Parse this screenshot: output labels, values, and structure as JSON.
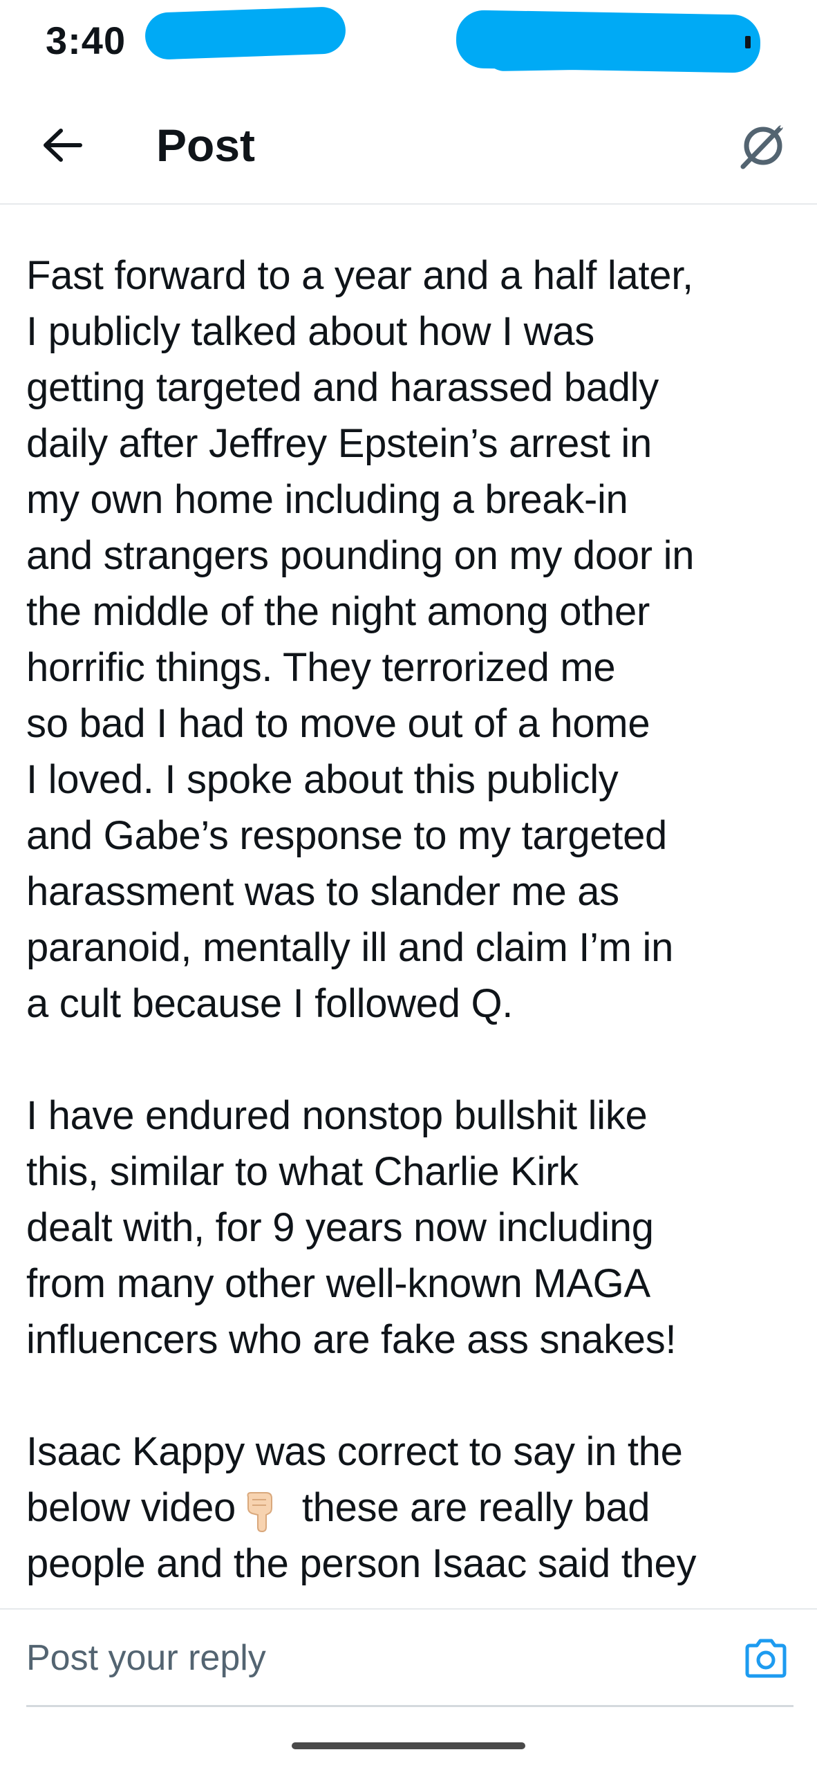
{
  "status_bar": {
    "time": "3:40"
  },
  "header": {
    "title": "Post"
  },
  "post": {
    "paragraphs": [
      {
        "lines": [
          "Fast forward to a year and a half later,",
          "I publicly talked about how I was",
          "getting targeted and harassed badly",
          "daily after Jeffrey Epstein’s arrest in",
          "my own home including a break-in",
          "and strangers pounding on my door in",
          "the middle of the night among other",
          "horrific things. They terrorized me",
          "so bad I had to move out of a home",
          "I loved. I spoke about this publicly",
          "and Gabe’s response to my targeted",
          "harassment was to slander me as",
          "paranoid, mentally ill and claim I’m in",
          "a cult because I followed Q."
        ]
      },
      {
        "lines": [
          "I have endured nonstop bullshit like",
          "this, similar to what Charlie Kirk",
          "dealt with, for 9 years now including",
          "from many other well-known MAGA",
          "influencers who are fake ass snakes!"
        ]
      },
      {
        "line1": "Isaac Kappy was correct to say in the",
        "line2_before": "below video",
        "line2_emoji": "backhand-index-pointing-down",
        "line2_after": " these are really bad",
        "line3": "people and the person Isaac said they"
      }
    ]
  },
  "reply": {
    "placeholder": "Post your reply"
  },
  "icons": {
    "back": "arrow-left-icon",
    "grok": "grok-icon",
    "camera": "camera-icon"
  },
  "colors": {
    "accent": "#1d9bf0",
    "text": "#0f1419",
    "secondary_text": "#536471",
    "divider": "#e6e9ec",
    "redaction": "#00aaf5"
  }
}
